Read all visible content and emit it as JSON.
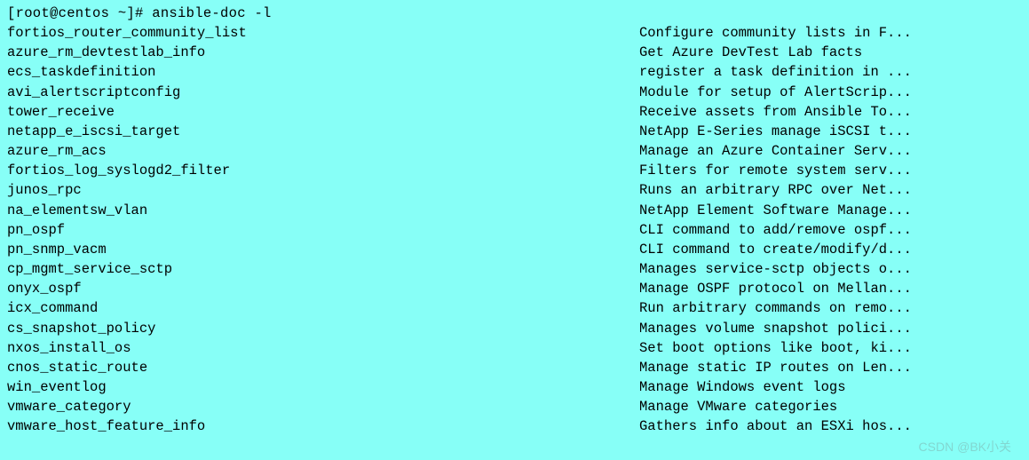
{
  "prompt": "[root@centos ~]# ansible-doc -l",
  "modules": [
    {
      "name": "fortios_router_community_list",
      "desc": "Configure community lists in F..."
    },
    {
      "name": "azure_rm_devtestlab_info",
      "desc": "Get Azure DevTest Lab facts"
    },
    {
      "name": "ecs_taskdefinition",
      "desc": "register a task definition in ..."
    },
    {
      "name": "avi_alertscriptconfig",
      "desc": "Module for setup of AlertScrip..."
    },
    {
      "name": "tower_receive",
      "desc": "Receive assets from Ansible To..."
    },
    {
      "name": "netapp_e_iscsi_target",
      "desc": "NetApp E-Series manage iSCSI t..."
    },
    {
      "name": "azure_rm_acs",
      "desc": "Manage an Azure Container Serv..."
    },
    {
      "name": "fortios_log_syslogd2_filter",
      "desc": "Filters for remote system serv..."
    },
    {
      "name": "junos_rpc",
      "desc": "Runs an arbitrary RPC over Net..."
    },
    {
      "name": "na_elementsw_vlan",
      "desc": "NetApp Element Software Manage..."
    },
    {
      "name": "pn_ospf",
      "desc": "CLI command to add/remove ospf..."
    },
    {
      "name": "pn_snmp_vacm",
      "desc": "CLI command to create/modify/d..."
    },
    {
      "name": "cp_mgmt_service_sctp",
      "desc": "Manages service-sctp objects o..."
    },
    {
      "name": "onyx_ospf",
      "desc": "Manage OSPF protocol on Mellan..."
    },
    {
      "name": "icx_command",
      "desc": "Run arbitrary commands on remo..."
    },
    {
      "name": "cs_snapshot_policy",
      "desc": "Manages volume snapshot polici..."
    },
    {
      "name": "nxos_install_os",
      "desc": "Set boot options like boot, ki..."
    },
    {
      "name": "cnos_static_route",
      "desc": "Manage static IP routes on Len..."
    },
    {
      "name": "win_eventlog",
      "desc": "Manage Windows event logs"
    },
    {
      "name": "vmware_category",
      "desc": "Manage VMware categories"
    },
    {
      "name": "vmware_host_feature_info",
      "desc": "Gathers info about an ESXi hos..."
    }
  ],
  "watermark": "CSDN @BK小关"
}
